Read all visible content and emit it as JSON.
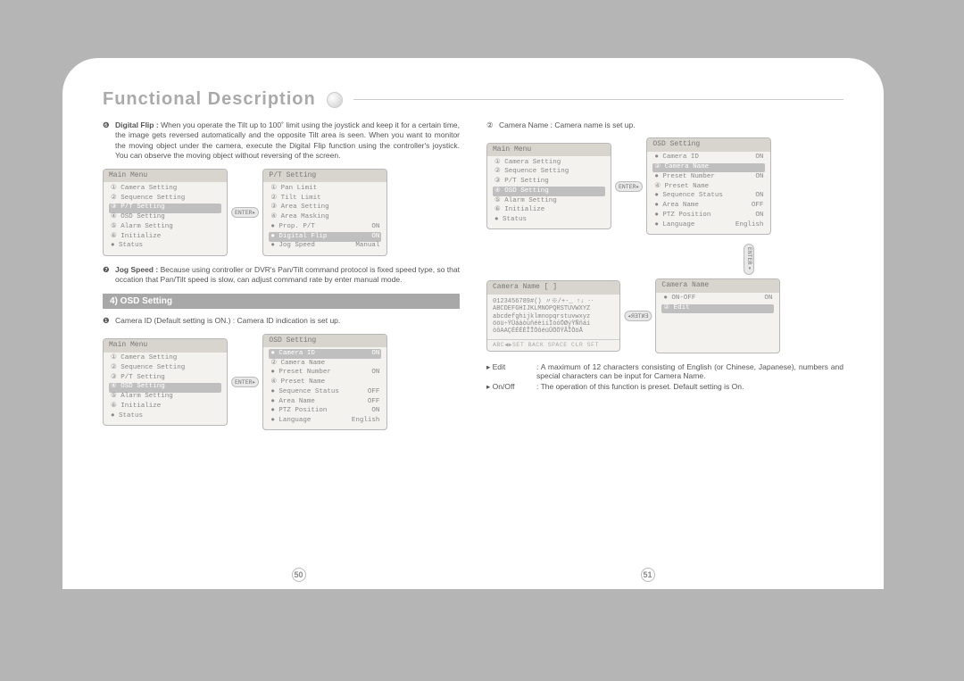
{
  "title": "Functional Description",
  "page_left": "50",
  "page_right": "51",
  "enter_label": "ENTER▸",
  "left": {
    "p6": {
      "num": "❻",
      "label": "Digital Flip : ",
      "text": "When you operate the Tilt up to 100˚ limit using the joystick and keep it for a certain time, the image gets reversed automatically and the opposite Tilt area is seen. When you want to monitor the moving object under the camera, execute the Digital Flip function using the controller's joystick. You can observe the moving object without reversing of the screen."
    },
    "p7": {
      "num": "❼",
      "label": "Jog Speed : ",
      "text": "Because using controller or DVR's Pan/Tilt command protocol is fixed speed type, so that occation that Pan/Tilt speed is slow, can adjust command rate by enter manual mode."
    },
    "section4_title": "4) OSD Setting",
    "item1": {
      "num": "❶",
      "text": "Camera ID (Default setting is ON.) : Camera ID indication is set up."
    },
    "menu_main": {
      "title": "Main Menu",
      "items": [
        "① Camera Setting",
        "② Sequence Setting",
        "③ P/T Setting",
        "④ OSD Setting",
        "⑤ Alarm Setting",
        "⑥ Initialize",
        "● Status"
      ]
    },
    "menu_pt": {
      "title": "P/T Setting",
      "items": [
        {
          "l": "① Pan Limit",
          "r": ""
        },
        {
          "l": "② Tilt Limit",
          "r": ""
        },
        {
          "l": "③ Area Setting",
          "r": ""
        },
        {
          "l": "④ Area Masking",
          "r": ""
        },
        {
          "l": "● Prop. P/T",
          "r": "ON"
        },
        {
          "l": "● Digital Flip",
          "r": "ON"
        },
        {
          "l": "● Jog Speed",
          "r": "Manual"
        }
      ]
    },
    "menu_main2": {
      "title": "Main Menu",
      "items": [
        "① Camera Setting",
        "② Sequence Setting",
        "③ P/T Setting",
        "④ OSD Setting",
        "⑤ Alarm Setting",
        "⑥ Initialize",
        "● Status"
      ]
    },
    "menu_osd": {
      "title": "OSD Setting",
      "items": [
        {
          "l": "● Camera ID",
          "r": "ON"
        },
        {
          "l": "② Camera Name",
          "r": ""
        },
        {
          "l": "● Preset Number",
          "r": "ON"
        },
        {
          "l": "④ Preset Name",
          "r": ""
        },
        {
          "l": "● Sequence Status",
          "r": "OFF"
        },
        {
          "l": "● Area Name",
          "r": "OFF"
        },
        {
          "l": "● PTZ Position",
          "r": "ON"
        },
        {
          "l": "● Language",
          "r": "English"
        }
      ]
    }
  },
  "right": {
    "item2": {
      "num": "②",
      "text": "Camera Name : Camera name is set up."
    },
    "menu_main": {
      "title": "Main Menu",
      "items": [
        "① Camera Setting",
        "② Sequence Setting",
        "③ P/T Setting",
        "④ OSD Setting",
        "⑤ Alarm Setting",
        "⑥ Initialize",
        "● Status"
      ]
    },
    "menu_osd": {
      "title": "OSD Setting",
      "items": [
        {
          "l": "● Camera ID",
          "r": "ON"
        },
        {
          "l": "② Camera Name",
          "r": ""
        },
        {
          "l": "● Preset Number",
          "r": "ON"
        },
        {
          "l": "④ Preset Name",
          "r": ""
        },
        {
          "l": "● Sequence Status",
          "r": "ON"
        },
        {
          "l": "● Area Name",
          "r": "OFF"
        },
        {
          "l": "● PTZ Position",
          "r": "ON"
        },
        {
          "l": "● Language",
          "r": "English"
        }
      ]
    },
    "menu_camname_edit": {
      "title": "Camera Name  [            ]",
      "body": "0123456789#()  〃※/+-_ ↑↓ ‥\nABCDEFGHIJKLMNOPQRSTUVWXYZ\nabcdefghijklmnopqrstuvwxyz\nööü÷ŸÜáàòùñéèìíÌòóÖØýŸÑñáí\nòôAAÇÉÉÉÈÎÎÒôéüÛÖÖŸÂÎÒöÅ",
      "footer": "ABC◀▶SET BACK SPACE CLR SFT"
    },
    "menu_camname": {
      "title": "Camera Name",
      "items": [
        {
          "l": "● ON-OFF",
          "r": "ON"
        },
        {
          "l": "② Edit",
          "r": ""
        }
      ]
    },
    "note_edit": {
      "mk": "▸ Edit",
      "tx": ": A maximum of 12 characters consisting of English (or Chinese, Japanese), numbers and special characters can be input for Camera Name."
    },
    "note_onoff": {
      "mk": "▸ On/Off",
      "tx": ": The operation of this function is preset. Default setting is On."
    }
  }
}
